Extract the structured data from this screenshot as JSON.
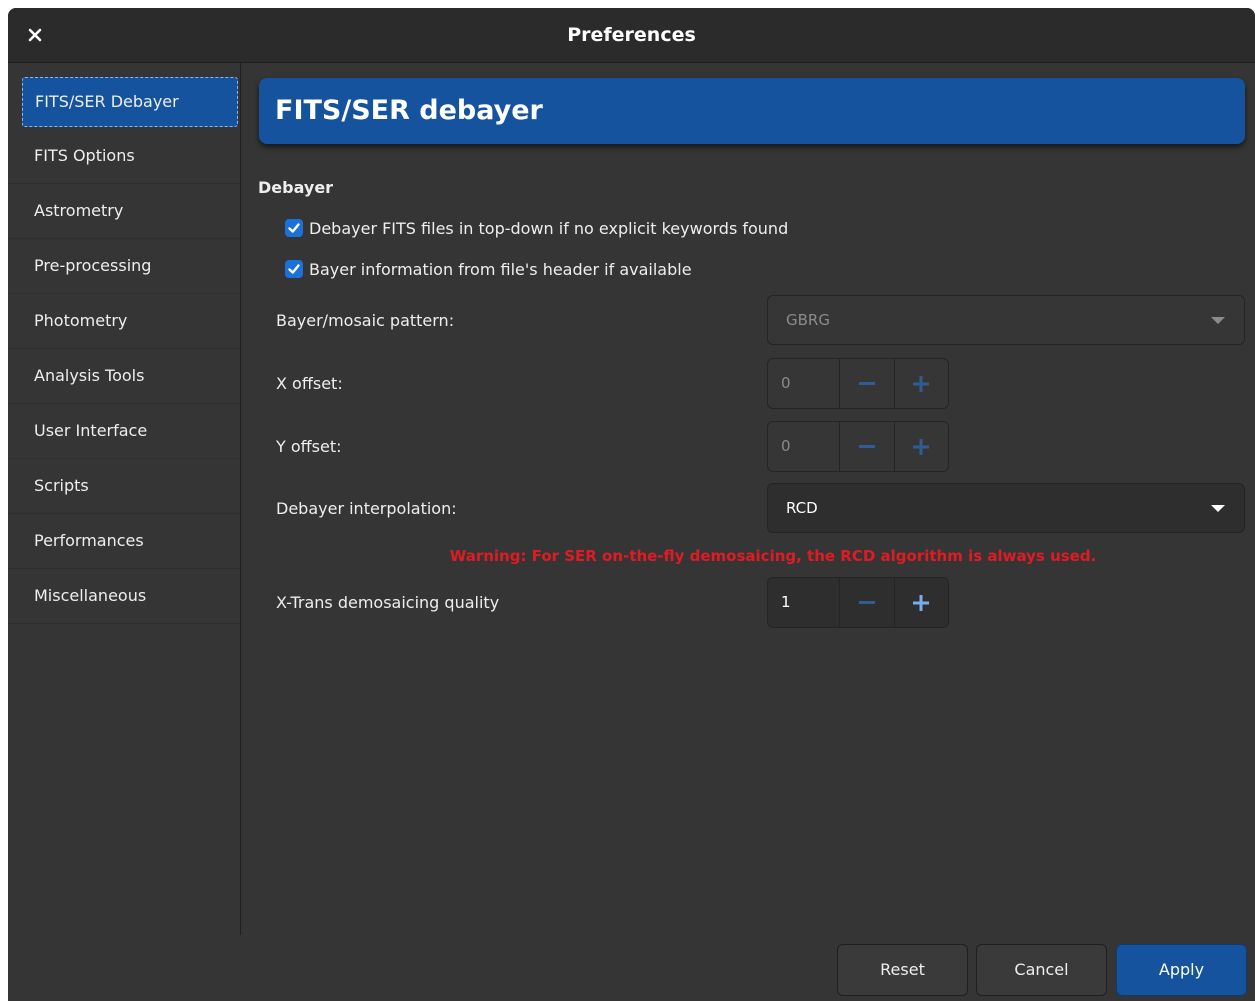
{
  "window": {
    "title": "Preferences"
  },
  "sidebar": {
    "items": [
      {
        "label": "FITS/SER Debayer"
      },
      {
        "label": "FITS Options"
      },
      {
        "label": "Astrometry"
      },
      {
        "label": "Pre-processing"
      },
      {
        "label": "Photometry"
      },
      {
        "label": "Analysis Tools"
      },
      {
        "label": "User Interface"
      },
      {
        "label": "Scripts"
      },
      {
        "label": "Performances"
      },
      {
        "label": "Miscellaneous"
      }
    ],
    "selected_index": 0
  },
  "page": {
    "header": "FITS/SER debayer",
    "section": "Debayer",
    "checkbox_topdown": {
      "label": "Debayer FITS files in top-down if no explicit keywords found",
      "checked": true
    },
    "checkbox_header": {
      "label": "Bayer information from file's header if available",
      "checked": true
    },
    "bayer_pattern": {
      "label": "Bayer/mosaic pattern:",
      "value": "GBRG",
      "enabled": false
    },
    "x_offset": {
      "label": "X offset:",
      "value": "0",
      "enabled": false
    },
    "y_offset": {
      "label": "Y offset:",
      "value": "0",
      "enabled": false
    },
    "interpolation": {
      "label": "Debayer interpolation:",
      "value": "RCD",
      "enabled": true
    },
    "warning": "Warning: For SER on-the-fly demosaicing, the RCD algorithm is always used.",
    "xtrans_quality": {
      "label": "X-Trans demosaicing quality",
      "value": "1",
      "enabled": true
    }
  },
  "footer": {
    "reset_label": "Reset",
    "cancel_label": "Cancel",
    "apply_label": "Apply"
  },
  "colors": {
    "accent": "#15539e",
    "checkbox": "#1c71d8",
    "warning": "#e01b24",
    "background": "#353535"
  }
}
